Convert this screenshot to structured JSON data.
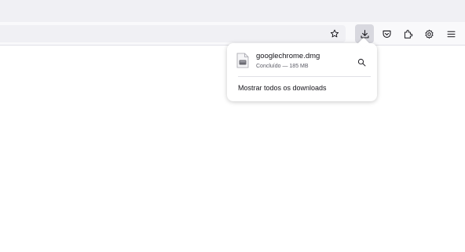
{
  "toolbar": {
    "icons": [
      "bookmark-star-icon",
      "downloads-icon",
      "pocket-icon",
      "extensions-icon",
      "settings-icon",
      "menu-icon"
    ],
    "active_button": "downloads"
  },
  "downloads_panel": {
    "items": [
      {
        "filename": "googlechrome.dmg",
        "status": "Concluído — 185 MB",
        "icon": "dmg-file-icon"
      }
    ],
    "show_all_label": "Mostrar todos os downloads"
  },
  "colors": {
    "toolbar_bg": "#f9f9fb",
    "tabstrip_bg": "#f0f0f4",
    "urlbar_bg": "#f0f0f4",
    "active_button_bg": "#d8d8df",
    "text": "#15141a"
  }
}
